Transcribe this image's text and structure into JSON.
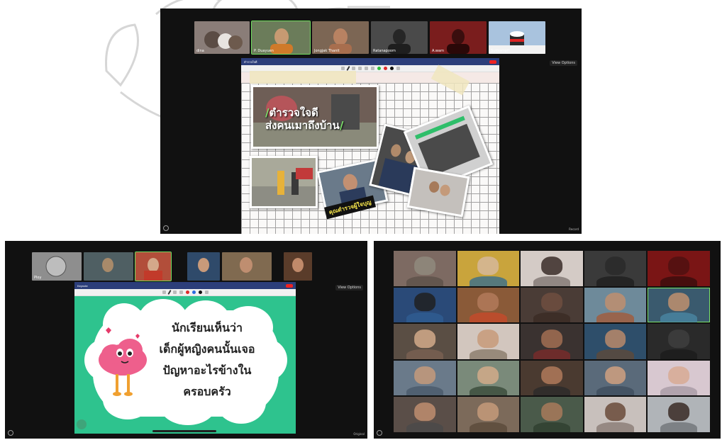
{
  "top_meeting": {
    "participants": [
      {
        "name": "dina",
        "color": "#8a7d78"
      },
      {
        "name": "P. Duayuen",
        "color": "#6b7c5a"
      },
      {
        "name": "Jongjak Thanit",
        "color": "#7c6654"
      },
      {
        "name": "Ratanapoom",
        "color": "#4a4a4a"
      },
      {
        "name": "A.warn",
        "color": "#7a1d1d"
      },
      {
        "name": "Sukkampit",
        "color": "#a9c3de"
      }
    ],
    "view_button": "View Options",
    "ipad_title": "ตำรวจใจดี",
    "slide": {
      "headline_line1": "ตำรวจใจดี",
      "headline_line2": "ส่งคนเมาถึงบ้าน",
      "label": "คุณตำรวจผู้ใจบุญ"
    },
    "footer_text": "Record"
  },
  "bl_meeting": {
    "participants": [
      {
        "name": "Ploy",
        "color": "#8e8e8e"
      },
      {
        "name": "",
        "color": "#4f5f63"
      },
      {
        "name": "",
        "color": "#b24e3a"
      },
      {
        "name": "",
        "color": "#2f4a6a"
      },
      {
        "name": "",
        "color": "#806a50"
      },
      {
        "name": "",
        "color": "#5a3c2a"
      }
    ],
    "view_button": "View Options",
    "ipad_title": "Keynote",
    "slide": {
      "line1": "นักเรียนเห็นว่า",
      "line2": "เด็กผู้หญิงคนนั้นเจอ",
      "line3": "ปัญหาอะไรข้างใน",
      "line4": "ครอบครัว"
    },
    "footer_text": "Original"
  },
  "gallery": {
    "tiles": [
      {
        "bg": "#7d6a62",
        "face": "#8f8a7e",
        "shirt": "#5d514a"
      },
      {
        "bg": "#c9a43c",
        "face": "#d6b89a",
        "shirt": "#3a6e8c"
      },
      {
        "bg": "#d4cbc6",
        "face": "#3a2d28",
        "shirt": "#7f7572"
      },
      {
        "bg": "#3a3a3a",
        "face": "#2a2a2a",
        "shirt": "#1f1f1f"
      },
      {
        "bg": "#7a1515",
        "face": "#501010",
        "shirt": "#3a0c0c"
      },
      {
        "bg": "#2a4a78",
        "face": "#202020",
        "shirt": "#2f5c92"
      },
      {
        "bg": "#8a5a38",
        "face": "#b27a5a",
        "shirt": "#c64a2a"
      },
      {
        "bg": "#4a3c36",
        "face": "#6e4e40",
        "shirt": "#3a2a24"
      },
      {
        "bg": "#6e8a9a",
        "face": "#c08e6e",
        "shirt": "#a25a3a"
      },
      {
        "bg": "#3a5a6e",
        "face": "#c0906e",
        "shirt": "#4a86a2"
      },
      {
        "bg": "#5a4e44",
        "face": "#d2aa8a",
        "shirt": "#7a6252"
      },
      {
        "bg": "#d2c6be",
        "face": "#c89a7a",
        "shirt": "#8a7a6a"
      },
      {
        "bg": "#3a3230",
        "face": "#a26e52",
        "shirt": "#7a2a2a"
      },
      {
        "bg": "#2e4e6a",
        "face": "#b88a6a",
        "shirt": "#5e4a3a"
      },
      {
        "bg": "#2a2a2a",
        "face": "#3e3e3e",
        "shirt": "#1c1c1c"
      },
      {
        "bg": "#6a7a8a",
        "face": "#c49a7a",
        "shirt": "#4a5a6a"
      },
      {
        "bg": "#7a8a7a",
        "face": "#d2aa8a",
        "shirt": "#3a4a3a"
      },
      {
        "bg": "#4a3a30",
        "face": "#b07a5a",
        "shirt": "#2a2a2a"
      },
      {
        "bg": "#5a6a7a",
        "face": "#d0a080",
        "shirt": "#3e4e5e"
      },
      {
        "bg": "#d8c8d0",
        "face": "#d8aa94",
        "shirt": "#a89aa4"
      },
      {
        "bg": "#5a4e48",
        "face": "#bf8e70",
        "shirt": "#4a4a4a"
      },
      {
        "bg": "#7c6a5a",
        "face": "#c69a7a",
        "shirt": "#5a4a3a"
      },
      {
        "bg": "#4a5a4a",
        "face": "#a87a5a",
        "shirt": "#2e3e2e"
      },
      {
        "bg": "#c8c0bc",
        "face": "#6a4a3a",
        "shirt": "#8a7a74"
      },
      {
        "bg": "#b0b4b8",
        "face": "#3a2a24",
        "shirt": "#707478"
      }
    ]
  }
}
